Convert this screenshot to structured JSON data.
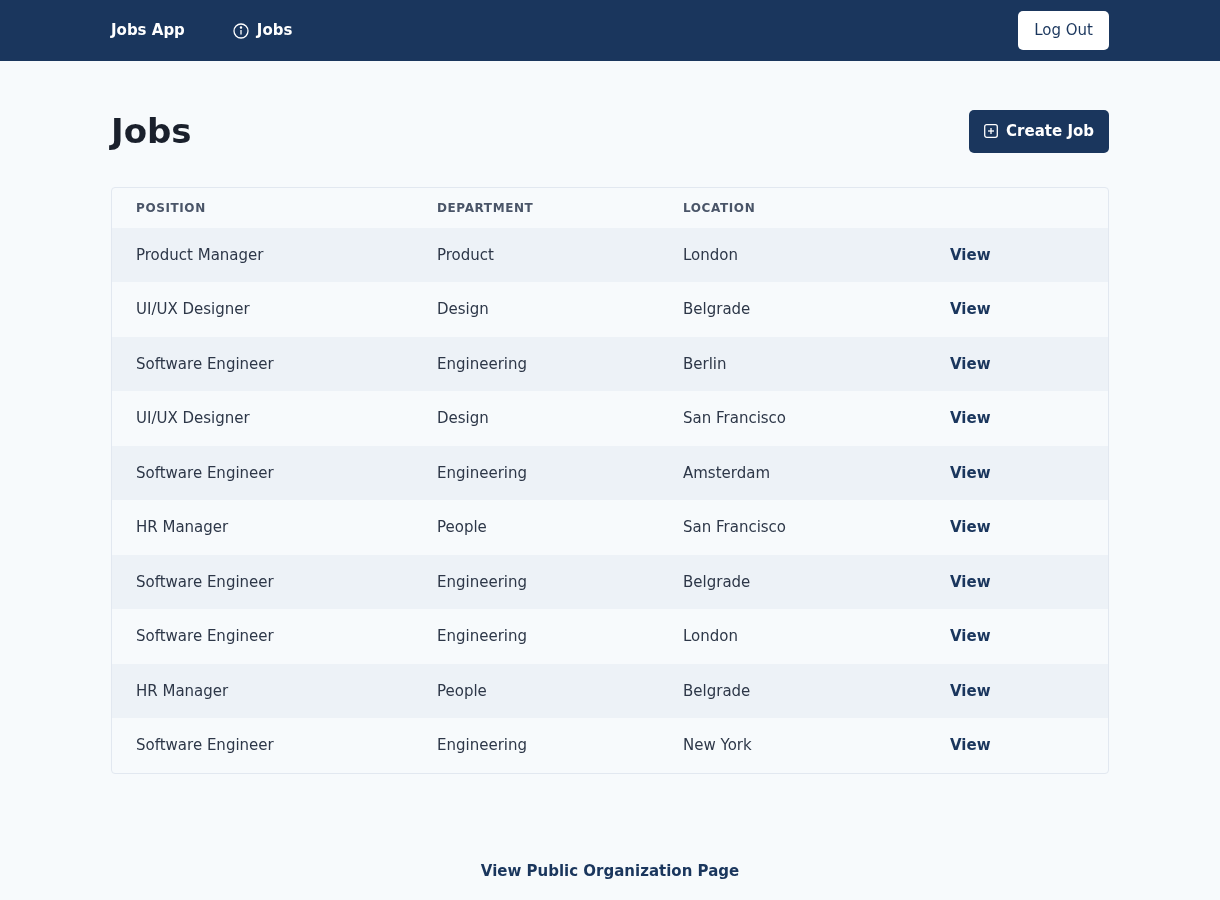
{
  "navbar": {
    "brand": "Jobs App",
    "links": [
      {
        "label": "Jobs"
      }
    ],
    "logout": "Log Out"
  },
  "page": {
    "title": "Jobs",
    "create_button": "Create Job"
  },
  "table": {
    "columns": [
      "POSITION",
      "DEPARTMENT",
      "LOCATION"
    ],
    "rows": [
      {
        "position": "Product Manager",
        "department": "Product",
        "location": "London",
        "action": "View"
      },
      {
        "position": "UI/UX Designer",
        "department": "Design",
        "location": "Belgrade",
        "action": "View"
      },
      {
        "position": "Software Engineer",
        "department": "Engineering",
        "location": "Berlin",
        "action": "View"
      },
      {
        "position": "UI/UX Designer",
        "department": "Design",
        "location": "San Francisco",
        "action": "View"
      },
      {
        "position": "Software Engineer",
        "department": "Engineering",
        "location": "Amsterdam",
        "action": "View"
      },
      {
        "position": "HR Manager",
        "department": "People",
        "location": "San Francisco",
        "action": "View"
      },
      {
        "position": "Software Engineer",
        "department": "Engineering",
        "location": "Belgrade",
        "action": "View"
      },
      {
        "position": "Software Engineer",
        "department": "Engineering",
        "location": "London",
        "action": "View"
      },
      {
        "position": "HR Manager",
        "department": "People",
        "location": "Belgrade",
        "action": "View"
      },
      {
        "position": "Software Engineer",
        "department": "Engineering",
        "location": "New York",
        "action": "View"
      }
    ]
  },
  "footer": {
    "link": "View Public Organization Page"
  }
}
